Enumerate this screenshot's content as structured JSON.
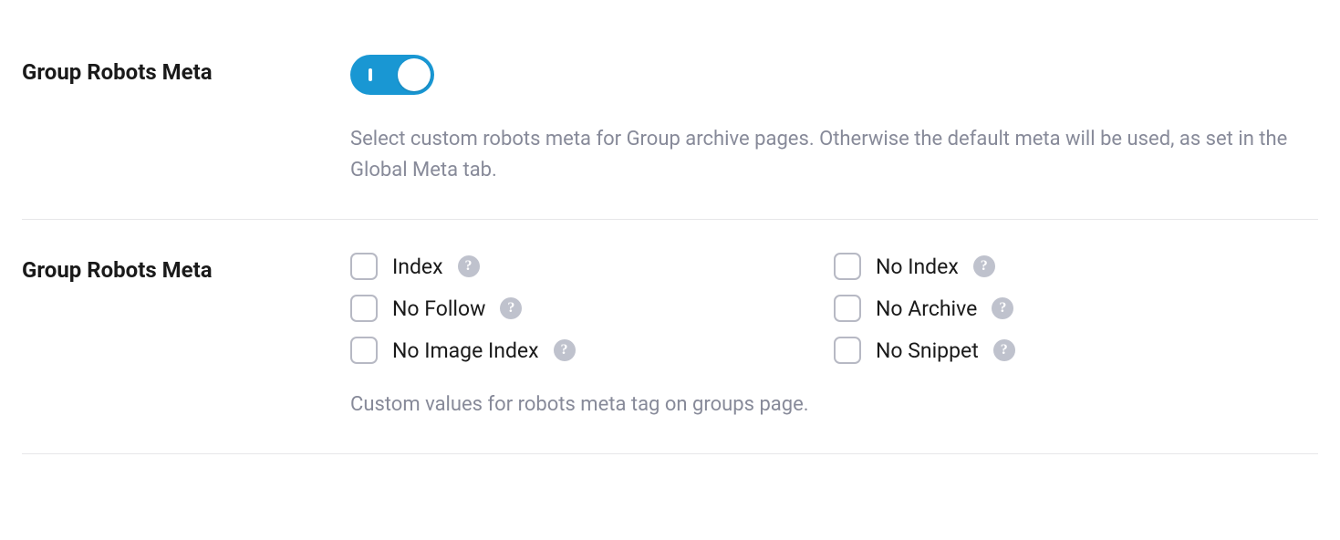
{
  "settings": {
    "toggle_row": {
      "label": "Group Robots Meta",
      "enabled": true,
      "description": "Select custom robots meta for Group archive pages. Otherwise the default meta will be used, as set in the Global Meta tab."
    },
    "checkbox_row": {
      "label": "Group Robots Meta",
      "options": [
        {
          "label": "Index",
          "checked": false,
          "help": true
        },
        {
          "label": "No Index",
          "checked": false,
          "help": true
        },
        {
          "label": "No Follow",
          "checked": false,
          "help": true
        },
        {
          "label": "No Archive",
          "checked": false,
          "help": true
        },
        {
          "label": "No Image Index",
          "checked": false,
          "help": true
        },
        {
          "label": "No Snippet",
          "checked": false,
          "help": true
        }
      ],
      "description": "Custom values for robots meta tag on groups page."
    }
  }
}
